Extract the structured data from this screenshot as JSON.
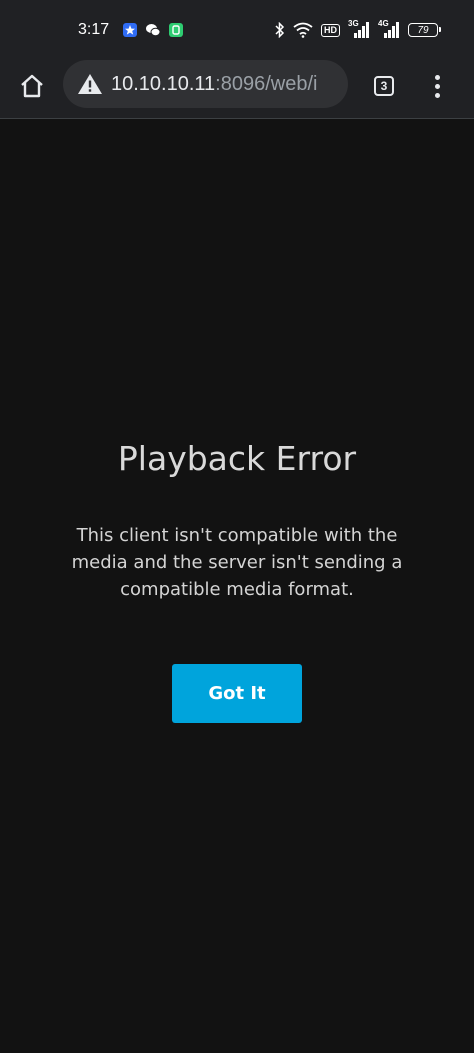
{
  "status_bar": {
    "time": "3:17",
    "hd_badge": "HD",
    "net1_label": "3G",
    "net2_label": "4G",
    "battery_level": "79",
    "icons": [
      "map-pin-app-icon",
      "wechat-icon",
      "green-app-icon",
      "bluetooth-icon",
      "wifi-icon",
      "hd-badge",
      "signal-3g-icon",
      "signal-4g-icon",
      "battery-icon"
    ]
  },
  "browser": {
    "url_host": "10.10.10.11",
    "url_rest": ":8096/web/i",
    "tab_count": "3",
    "security_icon": "not-secure-warning-icon"
  },
  "dialog": {
    "title": "Playback Error",
    "message": "This client isn't compatible with the media and the server isn't sending a compatible media format.",
    "button_label": "Got It"
  },
  "colors": {
    "background": "#121212",
    "toolbar": "#202124",
    "accent_button": "#00a4dc"
  }
}
